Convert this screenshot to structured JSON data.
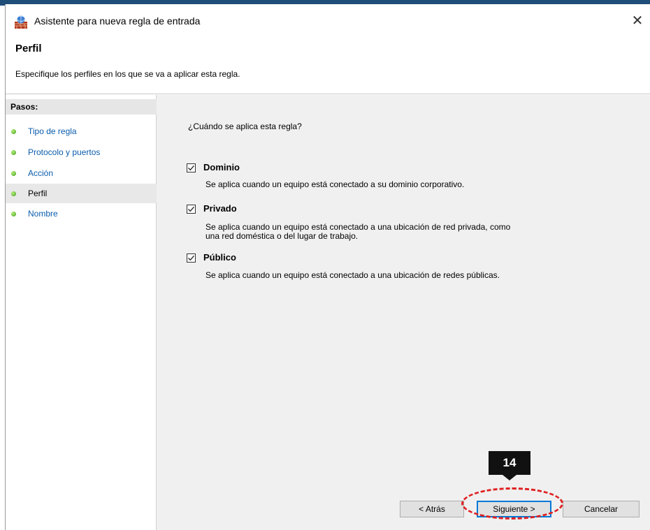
{
  "window": {
    "title": "Asistente para nueva regla de entrada",
    "close_label": "✕"
  },
  "header": {
    "title": "Perfil",
    "subtitle": "Especifique los perfiles en los que se va a aplicar esta regla."
  },
  "sidebar": {
    "title": "Pasos:",
    "items": [
      {
        "label": "Tipo de regla"
      },
      {
        "label": "Protocolo y puertos"
      },
      {
        "label": "Acción"
      },
      {
        "label": "Perfil"
      },
      {
        "label": "Nombre"
      }
    ],
    "current_index": 3
  },
  "content": {
    "question": "¿Cuándo se aplica esta regla?",
    "options": [
      {
        "label": "Dominio",
        "checked": true,
        "description": [
          "Se aplica cuando un equipo está conectado a su dominio corporativo."
        ]
      },
      {
        "label": "Privado",
        "checked": true,
        "description": [
          "Se aplica cuando un equipo está conectado a una ubicación de red privada, como",
          "una red doméstica o del lugar de trabajo."
        ]
      },
      {
        "label": "Público",
        "checked": true,
        "description": [
          "Se aplica cuando un equipo está conectado a una ubicación de redes públicas."
        ]
      }
    ]
  },
  "buttons": {
    "back": "< Atrás",
    "next": "Siguiente >",
    "cancel": "Cancelar"
  },
  "annotation": {
    "step_number": "14",
    "highlight_color": "#e02020"
  },
  "colors": {
    "link": "#0b5cad",
    "accent": "#0078d7",
    "step_dot": "#3f9b1c"
  }
}
